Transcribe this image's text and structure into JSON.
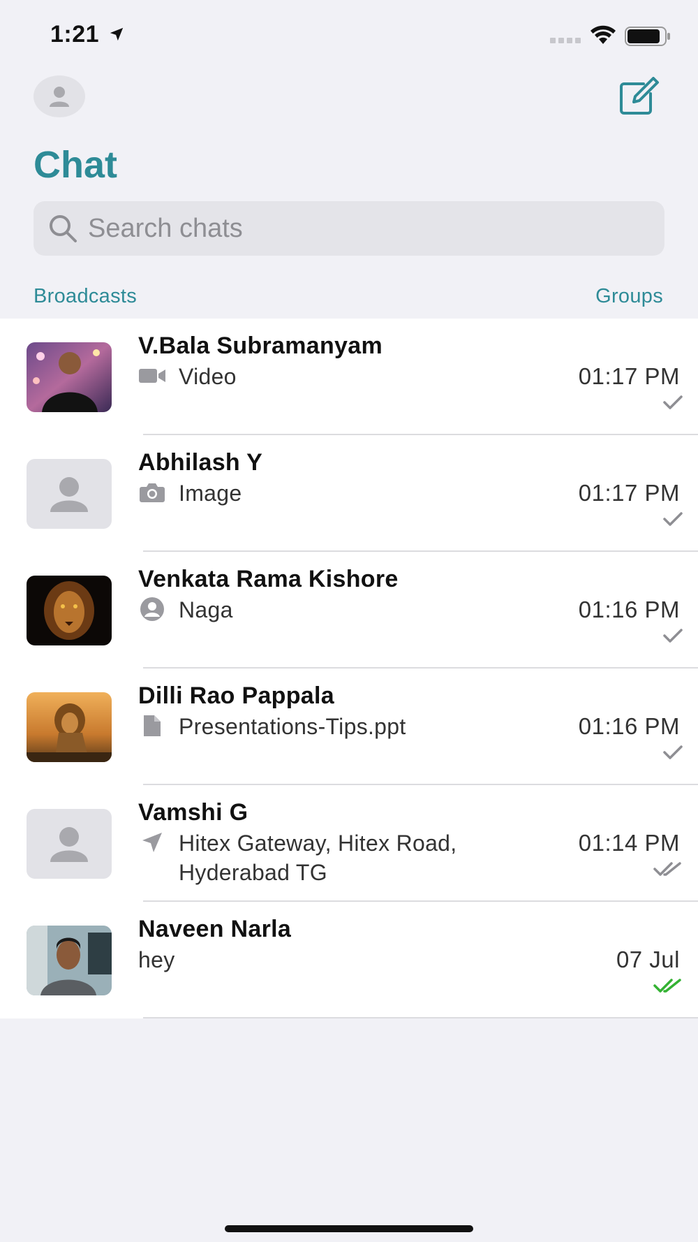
{
  "status": {
    "time": "1:21"
  },
  "header": {
    "title": "Chat",
    "search_placeholder": "Search chats",
    "broadcasts_label": "Broadcasts",
    "groups_label": "Groups"
  },
  "colors": {
    "accent": "#2e8b97",
    "tick_gray": "#8e8e93",
    "tick_read": "#34b233"
  },
  "chats": [
    {
      "name": "V.Bala Subramanyam",
      "preview_icon": "video-icon",
      "preview": "Video",
      "time": "01:17 PM",
      "status": "sent"
    },
    {
      "name": "Abhilash Y",
      "preview_icon": "camera-icon",
      "preview": "Image",
      "time": "01:17 PM",
      "status": "sent"
    },
    {
      "name": "Venkata Rama Kishore",
      "preview_icon": "contact-icon",
      "preview": "Naga",
      "time": "01:16 PM",
      "status": "sent"
    },
    {
      "name": "Dilli Rao Pappala",
      "preview_icon": "document-icon",
      "preview": "Presentations-Tips.ppt",
      "time": "01:16 PM",
      "status": "sent"
    },
    {
      "name": "Vamshi G",
      "preview_icon": "location-icon",
      "preview": "Hitex Gateway, Hitex Road, Hyderabad TG",
      "time": "01:14 PM",
      "status": "delivered"
    },
    {
      "name": "Naveen Narla",
      "preview_icon": "",
      "preview": "hey",
      "time": "07 Jul",
      "status": "read"
    }
  ]
}
